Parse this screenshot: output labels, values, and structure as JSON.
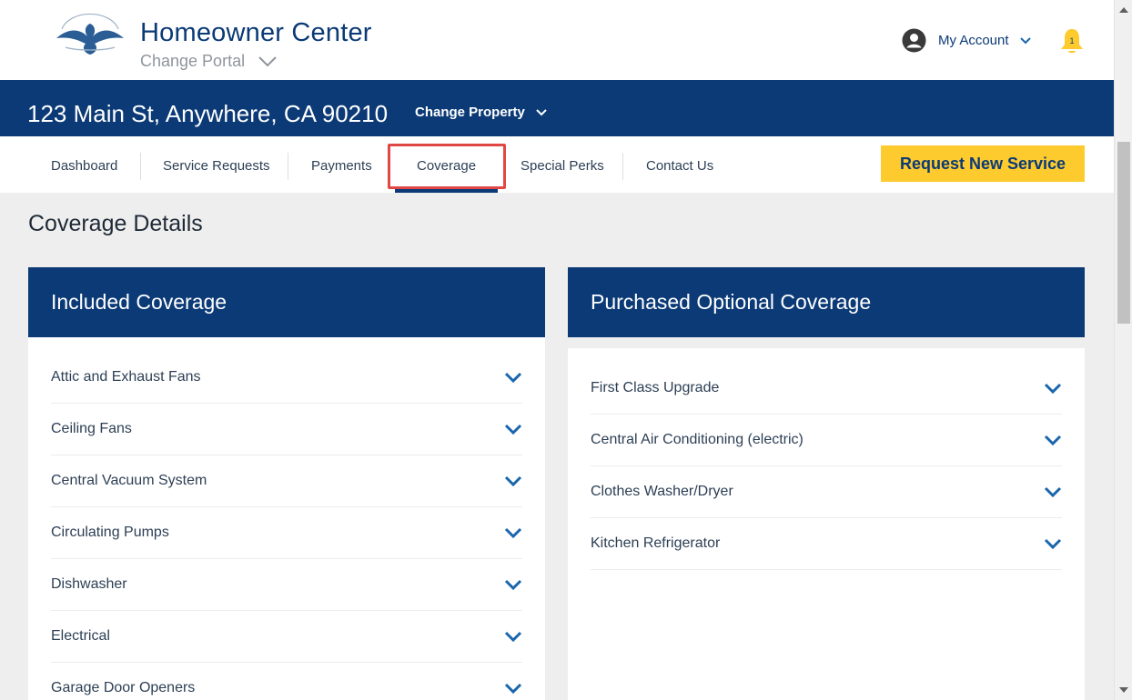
{
  "header": {
    "app_title": "Homeowner Center",
    "change_portal_label": "Change Portal",
    "account_label": "My Account",
    "notification_count": "1"
  },
  "property": {
    "address": "123 Main St, Anywhere, CA 90210",
    "change_label": "Change Property"
  },
  "nav": {
    "items": [
      {
        "label": "Dashboard"
      },
      {
        "label": "Service Requests"
      },
      {
        "label": "Payments"
      },
      {
        "label": "Coverage"
      },
      {
        "label": "Special Perks"
      },
      {
        "label": "Contact Us"
      }
    ],
    "active": "Coverage",
    "request_button_label": "Request New Service"
  },
  "page": {
    "title": "Coverage Details"
  },
  "included": {
    "title": "Included Coverage",
    "items": [
      {
        "label": "Attic and Exhaust Fans"
      },
      {
        "label": "Ceiling Fans"
      },
      {
        "label": "Central Vacuum System"
      },
      {
        "label": "Circulating Pumps"
      },
      {
        "label": "Dishwasher"
      },
      {
        "label": "Electrical"
      },
      {
        "label": "Garage Door Openers"
      }
    ]
  },
  "optional": {
    "title": "Purchased Optional Coverage",
    "items": [
      {
        "label": "First Class Upgrade"
      },
      {
        "label": "Central Air Conditioning (electric)"
      },
      {
        "label": "Clothes Washer/Dryer"
      },
      {
        "label": "Kitchen Refrigerator"
      }
    ]
  },
  "colors": {
    "brand_navy": "#0b3a76",
    "accent_yellow": "#fdcb2e",
    "highlight_red": "#e04745",
    "chevron_blue": "#1a66ad"
  }
}
